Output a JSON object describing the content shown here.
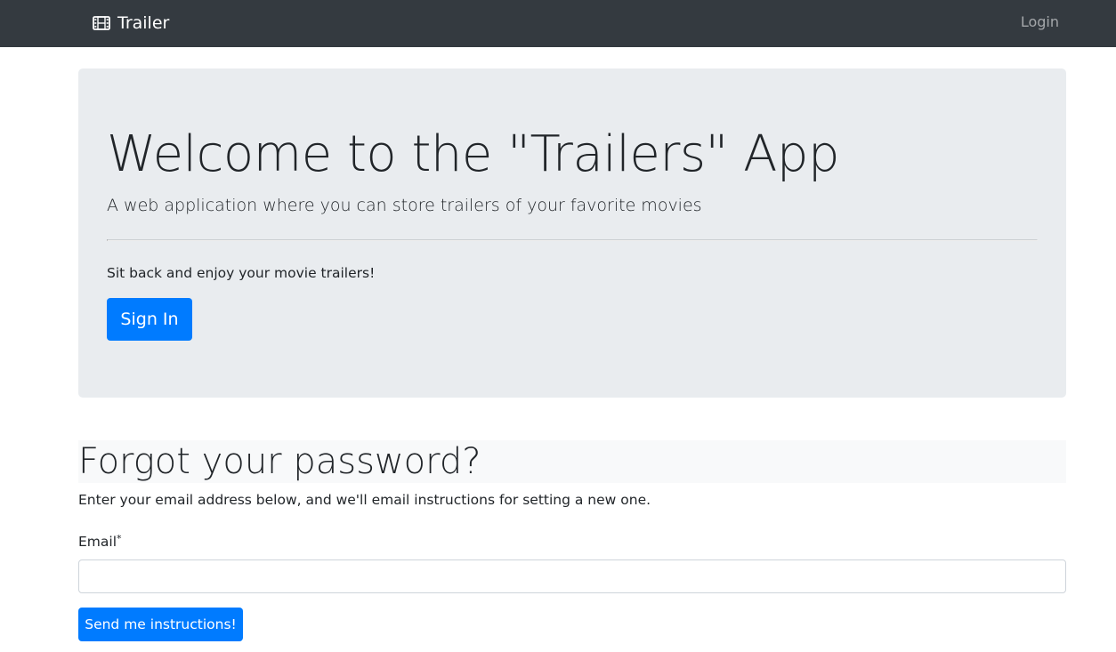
{
  "navbar": {
    "brand_icon": "film-icon",
    "brand_label": "Trailer",
    "login_label": "Login",
    "background_color": "#343a40"
  },
  "jumbotron": {
    "title": "Welcome to the \"Trailers\" App",
    "lead": "A web application where you can store trailers of your favorite movies",
    "text": "Sit back and enjoy your movie trailers!",
    "signin_label": "Sign In",
    "background_color": "#e9ecef"
  },
  "forgot": {
    "title": "Forgot your password?",
    "description": "Enter your email address below, and we'll email instructions for setting a new one.",
    "email_label": "Email",
    "email_required_mark": "*",
    "email_value": "",
    "submit_label": "Send me instructions!"
  },
  "colors": {
    "primary": "#007bff"
  }
}
